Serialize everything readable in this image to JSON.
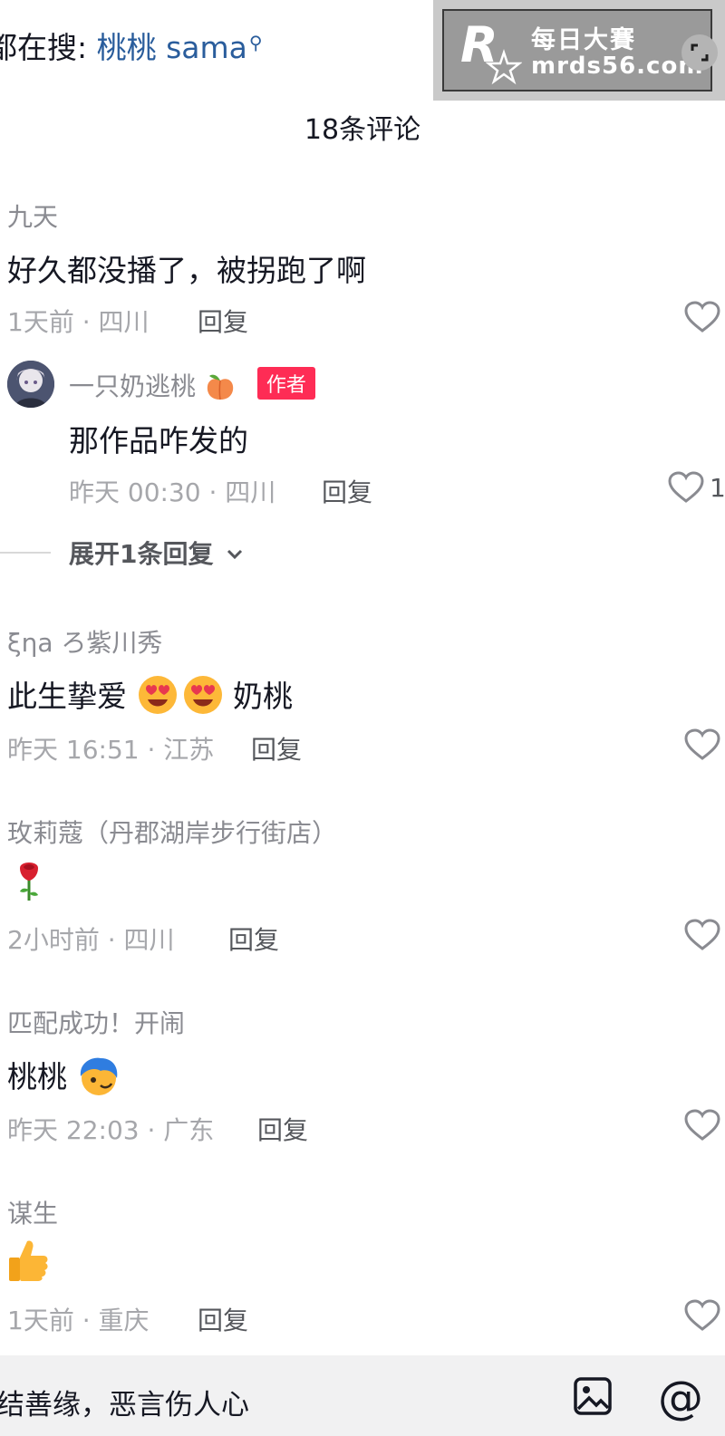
{
  "header": {
    "search_prefix": "都在搜:",
    "search_keyword": "桃桃 sama",
    "comment_count": "18条评论"
  },
  "watermark": {
    "line1": "每日大賽",
    "line2": "mrds56.com"
  },
  "comments": [
    {
      "name": "九天",
      "text": "好久都没播了，被拐跑了啊",
      "time": "1天前 · 四川",
      "reply": "回复"
    },
    {
      "name": "一只奶逃桃",
      "badge": "作者",
      "text": "那作品咋发的",
      "time": "昨天 00:30 · 四川",
      "reply": "回复",
      "likes": "1"
    },
    {
      "name": "ξηa ろ紫川秀",
      "text_prefix": "此生挚爱",
      "text_suffix": "奶桃",
      "time": "昨天 16:51 · 江苏",
      "reply": "回复"
    },
    {
      "name": "玫莉蔻（丹郡湖岸步行街店）",
      "time": "2小时前 · 四川",
      "reply": "回复"
    },
    {
      "name": "匹配成功！开闹",
      "text": "桃桃",
      "time": "昨天 22:03 · 广东",
      "reply": "回复"
    },
    {
      "name": "谋生",
      "time": "1天前 · 重庆",
      "reply": "回复"
    }
  ],
  "expand_replies": "展开1条回复",
  "input": {
    "placeholder": "结善缘，恶言伤人心"
  },
  "icons": {
    "heart": "heart-outline-icon",
    "image": "image-icon",
    "at": "at-icon",
    "search": "search-icon",
    "expand": "expand-icon"
  },
  "colors": {
    "author_badge": "#fe2c55",
    "keyword": "#2a5d9c",
    "muted_text": "#a6a7ab"
  }
}
